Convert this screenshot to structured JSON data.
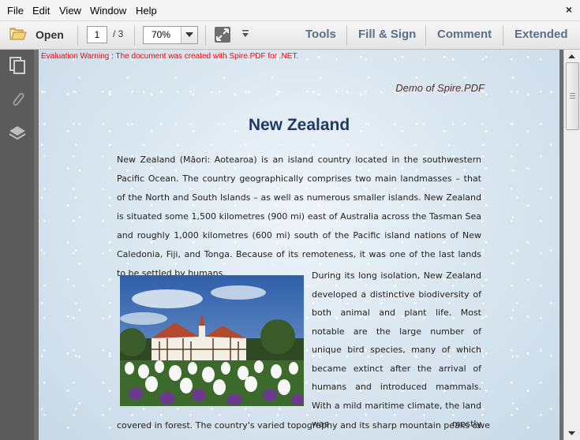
{
  "menu": {
    "file": "File",
    "edit": "Edit",
    "view": "View",
    "window": "Window",
    "help": "Help",
    "close_glyph": "×"
  },
  "toolbar": {
    "open_label": "Open",
    "current_page": "1",
    "page_total": "/ 3",
    "zoom": "70%",
    "tools": "Tools",
    "fill_sign": "Fill & Sign",
    "comment": "Comment",
    "extended": "Extended"
  },
  "document": {
    "eval_warning": "Evaluation Warning : The document was created with Spire.PDF for .NET.",
    "header_text": "Demo of Spire.PDF",
    "title": "New Zealand",
    "paragraph1": "New Zealand (Māori: Aotearoa) is an island country located in the southwestern Pacific Ocean. The country geographically comprises two main landmasses – that of the North and South Islands – as well as numerous smaller islands. New Zealand is situated some 1,500 kilometres (900 mi) east of Australia across the Tasman Sea and roughly 1,000 kilometres (600 mi) south of the Pacific island nations of New Caledonia, Fiji, and Tonga. Because of its remoteness, it was one of the last lands to be settled by humans.",
    "paragraph2": "During its long isolation, New Zealand developed a distinctive biodiversity of both animal and plant life. Most notable are the large number of unique bird species, many of which became extinct after the arrival of humans and introduced mammals. With a mild maritime climate, the land was mostly",
    "paragraph3": "covered in forest. The country's varied topography and its sharp mountain peaks owe"
  },
  "colors": {
    "title": "#1f3a63",
    "warning": "#ff0000",
    "toolbar_text": "#5a7089",
    "left_panel": "#5b5b5b"
  }
}
